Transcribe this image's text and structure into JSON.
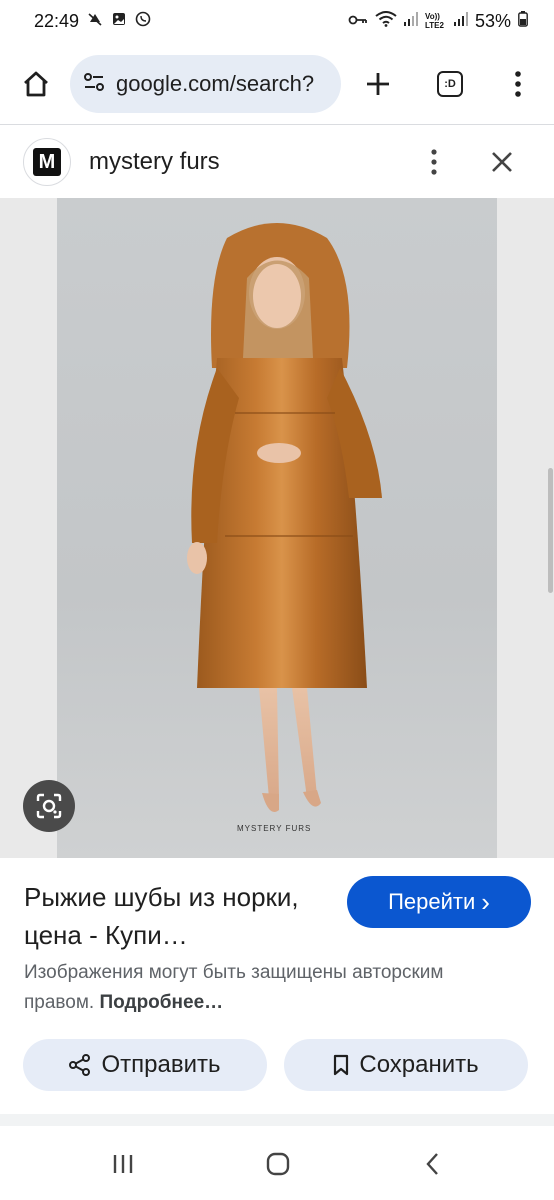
{
  "status_bar": {
    "time": "22:49",
    "battery": "53%",
    "lte_label": "Vo)) LTE2"
  },
  "browser": {
    "url": "google.com/search?",
    "tab_label": ":D"
  },
  "source": {
    "logo_letter": "M",
    "name": "mystery furs"
  },
  "image": {
    "watermark": "MYSTERY FURS"
  },
  "result": {
    "title": "Рыжие шубы из норки, цена - Купи…",
    "visit_label": "Перейти",
    "visit_chevron": "›",
    "copyright_text": "Изображения могут быть защищены авторским правом.",
    "copyright_link": "Подробнее…"
  },
  "actions": {
    "share_label": "Отправить",
    "save_label": "Сохранить"
  },
  "colors": {
    "accent": "#0b57d0",
    "pill_bg": "#e6ecf7",
    "url_bg": "#e6ecf5"
  },
  "icons": [
    "home-icon",
    "site-info-icon",
    "plus-icon",
    "tabs-icon",
    "more-vert-icon",
    "close-icon",
    "lens-icon",
    "share-icon",
    "bookmark-icon",
    "recents-icon",
    "home-nav-icon",
    "back-icon"
  ]
}
